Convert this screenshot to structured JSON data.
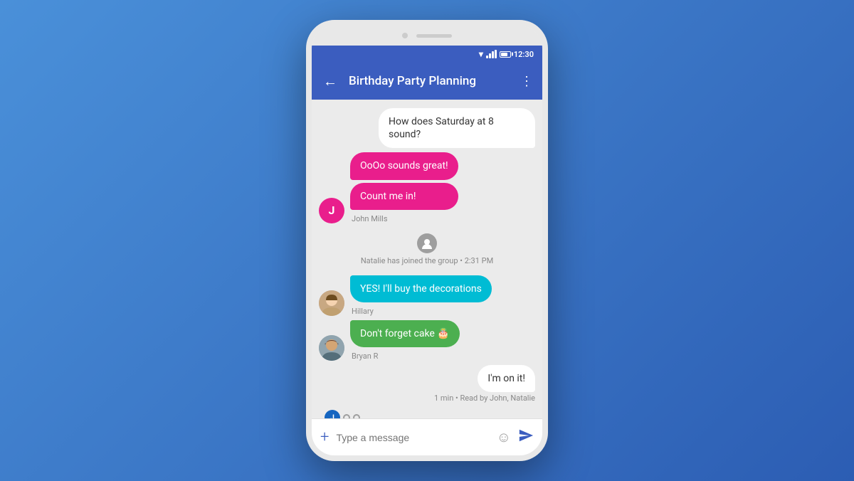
{
  "statusBar": {
    "time": "12:30"
  },
  "appBar": {
    "title": "Birthday Party Planning",
    "backLabel": "←",
    "moreLabel": "⋮"
  },
  "messages": [
    {
      "id": "msg1",
      "type": "outgoing",
      "text": "How does Saturday at 8 sound?",
      "bubbleStyle": "white"
    },
    {
      "id": "msg2",
      "type": "incoming-john",
      "texts": [
        "OoOo sounds great!",
        "Count me in!"
      ],
      "sender": "John Mills",
      "avatarInitial": "J"
    },
    {
      "id": "msg3",
      "type": "system",
      "text": "Natalie has joined the group • 2:31 PM"
    },
    {
      "id": "msg4",
      "type": "incoming-hillary",
      "text": "YES! I'll buy the decorations",
      "sender": "Hillary"
    },
    {
      "id": "msg5",
      "type": "incoming-bryan",
      "text": "Don't forget cake 🎂",
      "sender": "Bryan R"
    },
    {
      "id": "msg6",
      "type": "outgoing",
      "text": "I'm on it!",
      "bubbleStyle": "white",
      "readReceipt": "1 min • Read by John, Natalie"
    }
  ],
  "bottomBar": {
    "placeholder": "Type a message",
    "addIcon": "+",
    "emojiIcon": "☺",
    "sendIcon": "▷"
  }
}
